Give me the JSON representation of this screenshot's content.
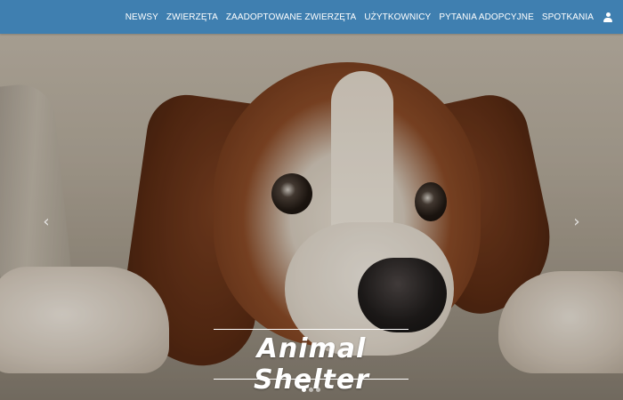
{
  "navbar": {
    "color": "#3f7fb0",
    "links": [
      "NEWSY",
      "ZWIERZĘTA",
      "ZAADOPTOWANE ZWIERZĘTA",
      "UŻYTKOWNICY",
      "PYTANIA ADOPCYJNE",
      "SPOTKANIA"
    ],
    "user_icon": "user-icon"
  },
  "carousel": {
    "prev_icon": "chevron-left-icon",
    "prev_glyph": "‹",
    "next_icon": "chevron-right-icon",
    "next_glyph": "›",
    "caption_title": "Animal Shelter",
    "slide_count": 3,
    "active_slide": 1
  }
}
